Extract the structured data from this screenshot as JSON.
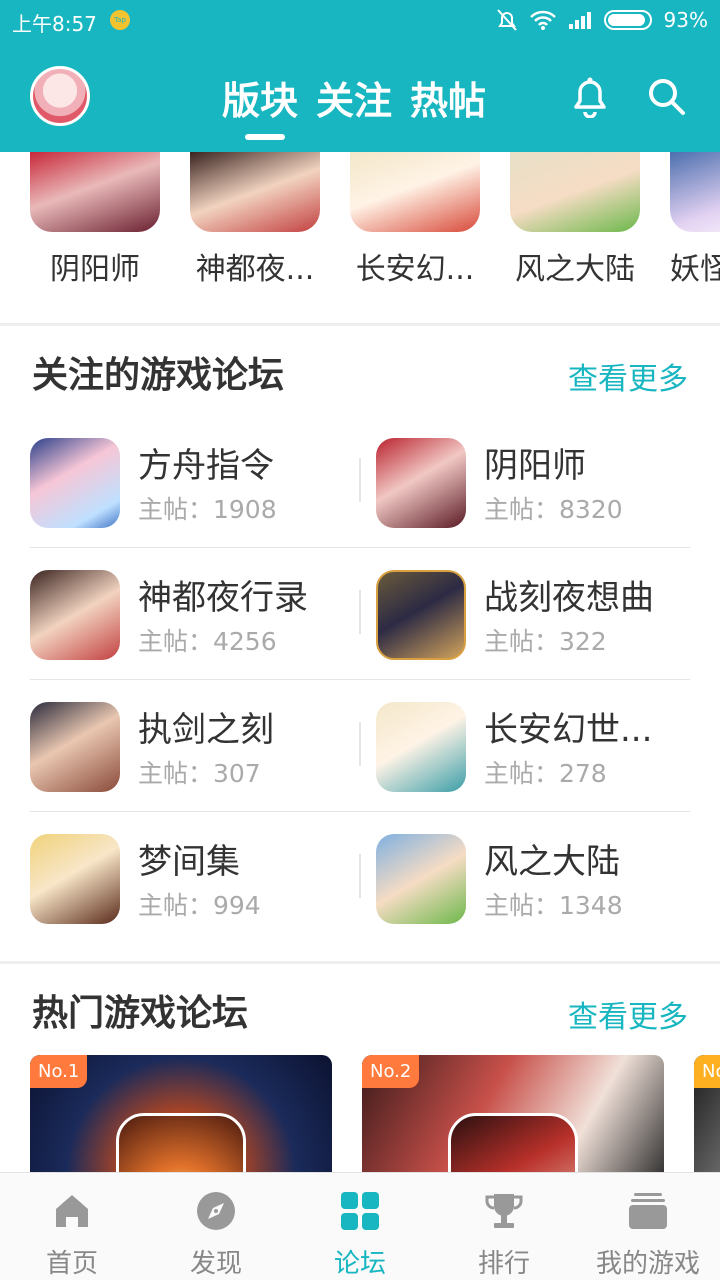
{
  "status_bar": {
    "time": "上午8:57",
    "battery_percent": "93%",
    "battery_level": 0.93
  },
  "header": {
    "tabs": [
      "版块",
      "关注",
      "热帖"
    ],
    "active_tab": "版块"
  },
  "top_games": [
    {
      "label": "阴阳师"
    },
    {
      "label": "神都夜..."
    },
    {
      "label": "长安幻..."
    },
    {
      "label": "风之大陆"
    },
    {
      "label": "妖怪"
    }
  ],
  "followed_section": {
    "title": "关注的游戏论坛",
    "more": "查看更多",
    "forums": [
      {
        "name": "方舟指令",
        "count": "主帖：1908"
      },
      {
        "name": "阴阳师",
        "count": "主帖：8320"
      },
      {
        "name": "神都夜行录",
        "count": "主帖：4256"
      },
      {
        "name": "战刻夜想曲",
        "count": "主帖：322"
      },
      {
        "name": "执剑之刻",
        "count": "主帖：307"
      },
      {
        "name": "长安幻世...",
        "count": "主帖：278"
      },
      {
        "name": "梦间集",
        "count": "主帖：994"
      },
      {
        "name": "风之大陆",
        "count": "主帖：1348"
      }
    ]
  },
  "hot_section": {
    "title": "热门游戏论坛",
    "more": "查看更多",
    "cards": [
      {
        "badge": "No.1"
      },
      {
        "badge": "No.2"
      },
      {
        "badge": "No"
      }
    ]
  },
  "bottom_nav": {
    "items": [
      "首页",
      "发现",
      "论坛",
      "排行",
      "我的游戏"
    ],
    "active": "论坛"
  },
  "colors": {
    "brand": "#17b6c0",
    "badge": "#ff7a3c"
  }
}
